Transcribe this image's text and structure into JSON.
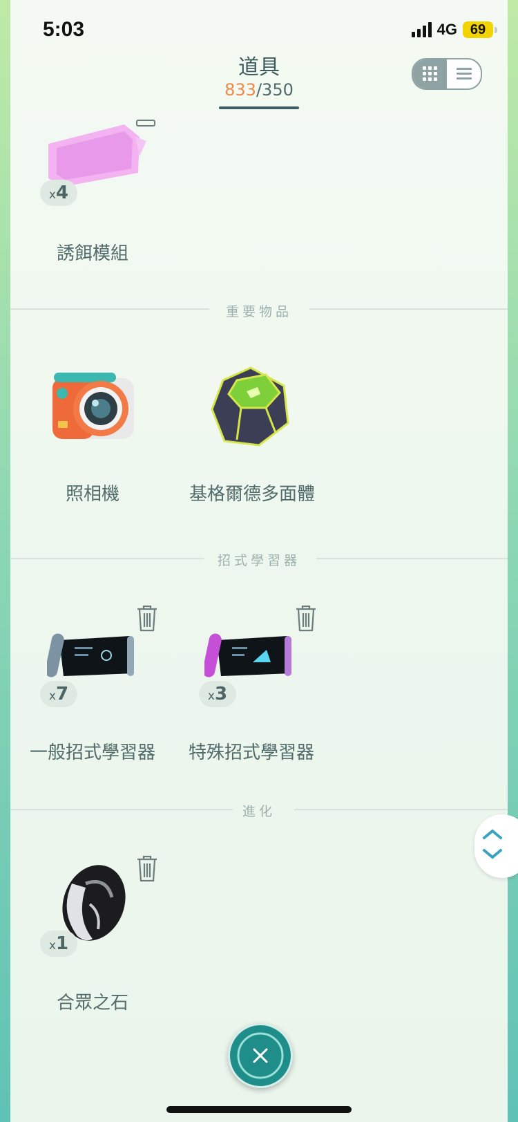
{
  "status_bar": {
    "time": "5:03",
    "network": "4G",
    "battery": "69"
  },
  "header": {
    "title": "道具",
    "count_current": "833",
    "count_separator": "/",
    "count_max": "350"
  },
  "sections": {
    "important": "重要物品",
    "tm": "招式學習器",
    "evolution": "進化"
  },
  "items": {
    "lure": {
      "name": "誘餌模組",
      "qty": "4"
    },
    "camera": {
      "name": "照相機"
    },
    "zygarde": {
      "name": "基格爾德多面體"
    },
    "fast_tm": {
      "name": "一般招式學習器",
      "qty": "7"
    },
    "charged_tm": {
      "name": "特殊招式學習器",
      "qty": "3"
    },
    "linking_stone": {
      "name": "合眾之石",
      "qty": "1"
    }
  },
  "qty_prefix": "x",
  "colors": {
    "accent_orange": "#f08a4b",
    "close_button": "#1f8d8a",
    "text": "#526b6b"
  }
}
